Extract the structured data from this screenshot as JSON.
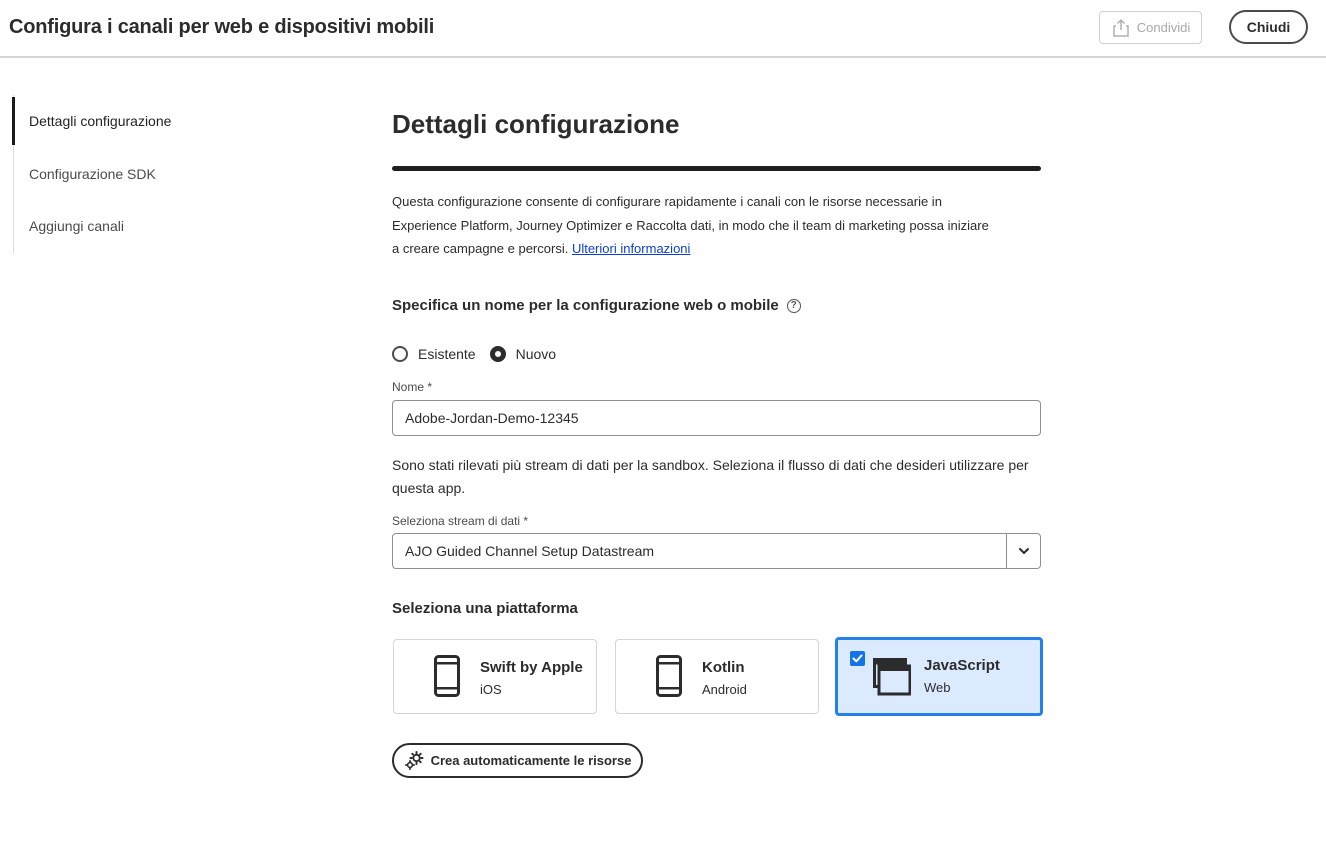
{
  "header": {
    "title": "Configura i canali per web e dispositivi mobili",
    "share_label": "Condividi",
    "close_label": "Chiudi"
  },
  "sidebar": {
    "items": [
      {
        "label": "Dettagli configurazione",
        "active": true
      },
      {
        "label": "Configurazione SDK",
        "active": false
      },
      {
        "label": "Aggiungi canali",
        "active": false
      }
    ]
  },
  "main": {
    "title": "Dettagli configurazione",
    "description": "Questa configurazione consente di configurare rapidamente i canali con le risorse necessarie in Experience Platform, Journey Optimizer e Raccolta dati, in modo che il team di marketing possa iniziare a creare campagne e percorsi.",
    "learn_more": "Ulteriori informazioni",
    "name_section_label": "Specifica un nome per la configurazione web o mobile",
    "radio_existing": "Esistente",
    "radio_new": "Nuovo",
    "radio_selected": "Nuovo",
    "name_label": "Nome",
    "required_mark": "*",
    "name_value": "Adobe-Jordan-Demo-12345",
    "info_text": "Sono stati rilevati più stream di dati per la sandbox. Seleziona il flusso di dati che desideri utilizzare per questa app.",
    "datastream_label": "Seleziona stream di dati",
    "datastream_value": "AJO Guided Channel Setup Datastream",
    "platform_label": "Seleziona una piattaforma",
    "platforms": [
      {
        "title": "Swift by Apple",
        "subtitle": "iOS",
        "icon": "mobile-phone-icon",
        "selected": false
      },
      {
        "title": "Kotlin",
        "subtitle": "Android",
        "icon": "mobile-phone-icon",
        "selected": false
      },
      {
        "title": "JavaScript",
        "subtitle": "Web",
        "icon": "browser-windows-icon",
        "selected": true
      }
    ],
    "create_button": "Crea automaticamente le risorse"
  },
  "colors": {
    "accent": "#2680eb",
    "selected_bg": "#dbeafe",
    "checkbox": "#1473e6",
    "link": "#0b3fcc"
  }
}
